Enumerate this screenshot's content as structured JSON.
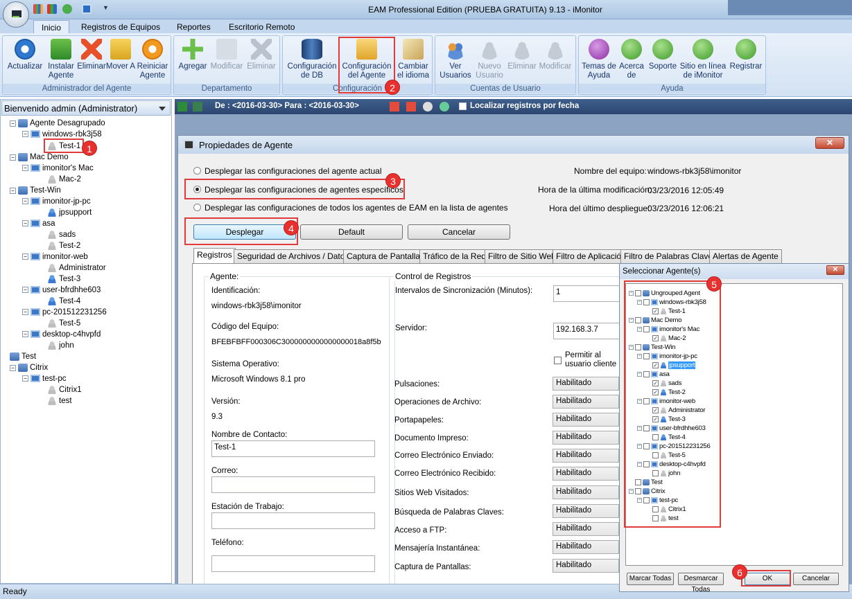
{
  "window": {
    "title": "EAM Professional Edition (PRUEBA GRATUITA) 9.13 - iMonitor"
  },
  "tabs": [
    "Inicio",
    "Registros de Equipos",
    "Reportes",
    "Escritorio Remoto"
  ],
  "ribbon": {
    "groups": [
      {
        "label": "Administrador del Agente",
        "buttons": [
          "Actualizar",
          "Instalar Agente",
          "Eliminar",
          "Mover A",
          "Reiniciar Agente"
        ]
      },
      {
        "label": "Departamento",
        "buttons": [
          "Agregar",
          "Modificar",
          "Eliminar"
        ]
      },
      {
        "label": "Configuración",
        "buttons": [
          "Configuración de DB",
          "Configuración del Agente",
          "Cambiar el idioma"
        ]
      },
      {
        "label": "Cuentas de Usuario",
        "buttons": [
          "Ver Usuarios",
          "Nuevo Usuario",
          "Eliminar",
          "Modificar"
        ]
      },
      {
        "label": "Ayuda",
        "buttons": [
          "Temas de Ayuda",
          "Acerca de",
          "Soporte",
          "Sitio en línea de iMonitor",
          "Registrar"
        ]
      }
    ]
  },
  "left": {
    "welcome": "Bienvenido admin (Administrator)",
    "tree": [
      "Agente Desagrupado",
      "windows-rbk3j58",
      "Test-1",
      "Mac Demo",
      "imonitor's Mac",
      "Mac-2",
      "Test-Win",
      "imonitor-jp-pc",
      "jpsupport",
      "asa",
      "sads",
      "Test-2",
      "imonitor-web",
      "Administrator",
      "Test-3",
      "user-bfrdhhe603",
      "Test-4",
      "pc-201512231256",
      "Test-5",
      "desktop-c4hvpfd",
      "john",
      "Test",
      "Citrix",
      "test-pc",
      "Citrix1",
      "test"
    ]
  },
  "toolbar2": {
    "range": "De : <2016-03-30> Para : <2016-03-30>",
    "locate": "Localizar registros por fecha"
  },
  "dialog": {
    "title": "Propiedades de Agente",
    "radios": [
      "Desplegar las configuraciones del agente actual",
      "Desplegar las configuraciones de agentes específicos",
      "Desplegar las configuraciones de todos los agentes de EAM en la lista de agentes"
    ],
    "info_labels": [
      "Nombre del equipo:",
      "Hora de la última modificación:",
      "Hora del último despliegue:"
    ],
    "info_values": [
      "windows-rbk3j58\\imonitor",
      "03/23/2016 12:05:49",
      "03/23/2016 12:06:21"
    ],
    "buttons": [
      "Desplegar",
      "Default",
      "Cancelar"
    ],
    "tabs": [
      "Registros",
      "Seguridad de Archivos / Datos",
      "Captura de Pantallas",
      "Tráfico de la Red",
      "Filtro de Sitio Web",
      "Filtro de Aplicación",
      "Filtro de Palabras Claves",
      "Alertas de Agente"
    ],
    "agent": {
      "title": "Agente:",
      "labels": [
        "Identificación:",
        "Código del Equipo:",
        "Sistema Operativo:",
        "Versión:",
        "Nombre de Contacto:",
        "Correo:",
        "Estación de Trabajo:",
        "Teléfono:"
      ],
      "values": [
        "windows-rbk3j58\\imonitor",
        "BFEBFBFF000306C3000000000000000018a8f5b",
        "Microsoft Windows 8.1 pro",
        "9.3"
      ],
      "contact": "Test-1"
    },
    "control": {
      "title": "Control de Registros",
      "sync_label": "Intervalos de Sincronización (Minutos):",
      "sync_value": "1",
      "server_label": "Servidor:",
      "server_value": "192.168.3.7",
      "allow": "Permitir al usuario cliente",
      "items": [
        "Pulsaciones:",
        "Operaciones de Archivo:",
        "Portapapeles:",
        "Documento Impreso:",
        "Correo Electrónico Enviado:",
        "Correo Electrónico Recibido:",
        "Sitios Web Visitados:",
        "Búsqueda de Palabras Claves:",
        "Acceso a FTP:",
        "Mensajería Instantánea:",
        "Captura de Pantallas:"
      ],
      "state": "Habilitado"
    }
  },
  "select": {
    "title": "Seleccionar Agente(s)",
    "tree": [
      "Ungrouped Agent",
      "windows-rbk3j58",
      "Test-1",
      "Mac Demo",
      "imonitor's Mac",
      "Mac-2",
      "Test-Win",
      "imonitor-jp-pc",
      "jpsupport",
      "asa",
      "sads",
      "Test-2",
      "imonitor-web",
      "Administrator",
      "Test-3",
      "user-bfrdhhe603",
      "Test-4",
      "pc-201512231256",
      "Test-5",
      "desktop-c4hvpfd",
      "john",
      "Test",
      "Citrix",
      "test-pc",
      "Citrix1",
      "test"
    ],
    "buttons": [
      "Marcar Todas",
      "Desmarcar Todas",
      "OK",
      "Cancelar"
    ]
  },
  "steps": [
    "1",
    "2",
    "3",
    "4",
    "5",
    "6"
  ],
  "status": "Ready",
  "colors": {
    "ribbon": "#dbe7f6",
    "accent": "#3e5c86",
    "marker": "#e03a3a",
    "badge": "#e8312f"
  }
}
